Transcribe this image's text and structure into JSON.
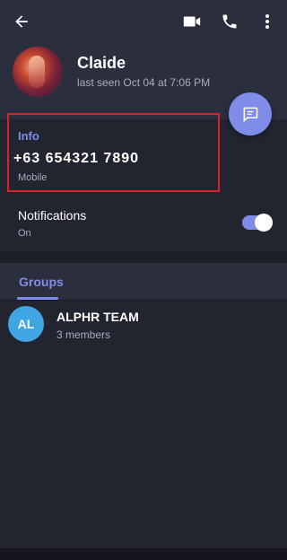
{
  "colors": {
    "background": "#222430",
    "header": "#2b2e3d",
    "accent": "#7f8de8",
    "highlight_box": "#d9212b",
    "group_avatar": "#40a6e3"
  },
  "toolbar": {
    "icons": [
      "back-arrow-icon",
      "video-call-icon",
      "phone-call-icon",
      "more-vert-icon"
    ]
  },
  "profile": {
    "name": "Claide",
    "last_seen": "last seen Oct 04 at 7:06 PM"
  },
  "info": {
    "title": "Info",
    "phone": "+63 654321 7890",
    "phone_type": "Mobile"
  },
  "notifications": {
    "label": "Notifications",
    "state": "On",
    "enabled": true
  },
  "tabs": {
    "active_label": "Groups"
  },
  "groups": [
    {
      "initials": "AL",
      "name": "ALPHR TEAM",
      "members": "3 members"
    }
  ]
}
